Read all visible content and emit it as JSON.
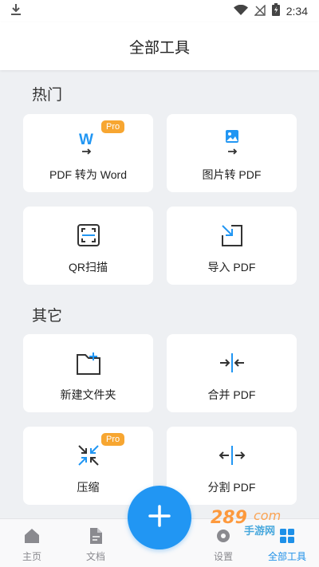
{
  "status_bar": {
    "time": "2:34"
  },
  "header": {
    "title": "全部工具"
  },
  "sections": {
    "hot": {
      "title": "热门",
      "items": [
        {
          "label": "PDF 转为 Word",
          "badge": "Pro",
          "icon": "word-convert-icon"
        },
        {
          "label": "图片转 PDF",
          "icon": "image-convert-icon"
        },
        {
          "label": "QR扫描",
          "icon": "qr-scan-icon"
        },
        {
          "label": "导入 PDF",
          "icon": "import-icon"
        }
      ]
    },
    "other": {
      "title": "其它",
      "items": [
        {
          "label": "新建文件夹",
          "icon": "new-folder-icon"
        },
        {
          "label": "合并 PDF",
          "icon": "merge-icon"
        },
        {
          "label": "压缩",
          "badge": "Pro",
          "icon": "compress-icon"
        },
        {
          "label": "分割 PDF",
          "icon": "split-icon"
        }
      ]
    }
  },
  "bottom_nav": {
    "items": [
      {
        "label": "主页",
        "icon": "home-icon"
      },
      {
        "label": "文档",
        "icon": "document-icon"
      },
      {
        "label": "设置",
        "icon": "settings-icon"
      },
      {
        "label": "全部工具",
        "icon": "grid-icon",
        "active": true
      }
    ]
  },
  "watermark": {
    "text": "289",
    "suffix": "com",
    "subtitle": "手游网"
  },
  "colors": {
    "accent": "#2196f3",
    "pro_badge": "#f7a631",
    "background": "#eef0f3",
    "active_nav": "#1e90e8"
  }
}
